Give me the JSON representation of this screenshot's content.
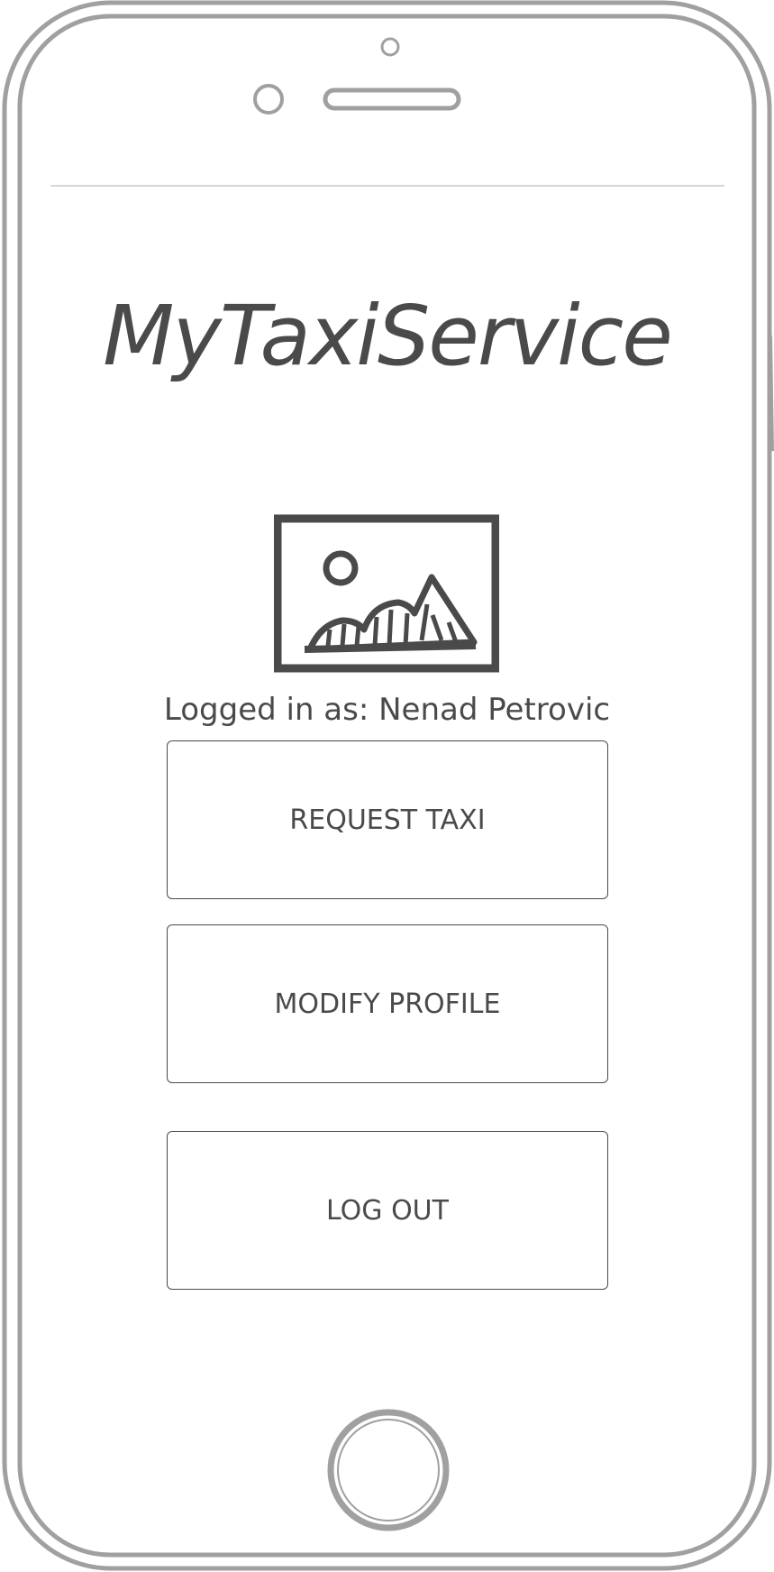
{
  "app": {
    "title": "MyTaxiService"
  },
  "session": {
    "logged_in_label": "Logged in as: Nenad Petrovic"
  },
  "menu": {
    "request_taxi_label": "REQUEST TAXI",
    "modify_profile_label": "MODIFY PROFILE",
    "log_out_label": "LOG OUT"
  },
  "icons": {
    "hero": "image-placeholder-icon",
    "camera": "front-camera-icon",
    "speaker": "earpiece-speaker-icon",
    "sensor": "proximity-sensor-icon",
    "home": "home-button-icon"
  },
  "colors": {
    "sketch_stroke": "#4a4a4a",
    "device_frame": "#a0a0a0",
    "divider": "#c8c8c8",
    "background": "#ffffff"
  }
}
